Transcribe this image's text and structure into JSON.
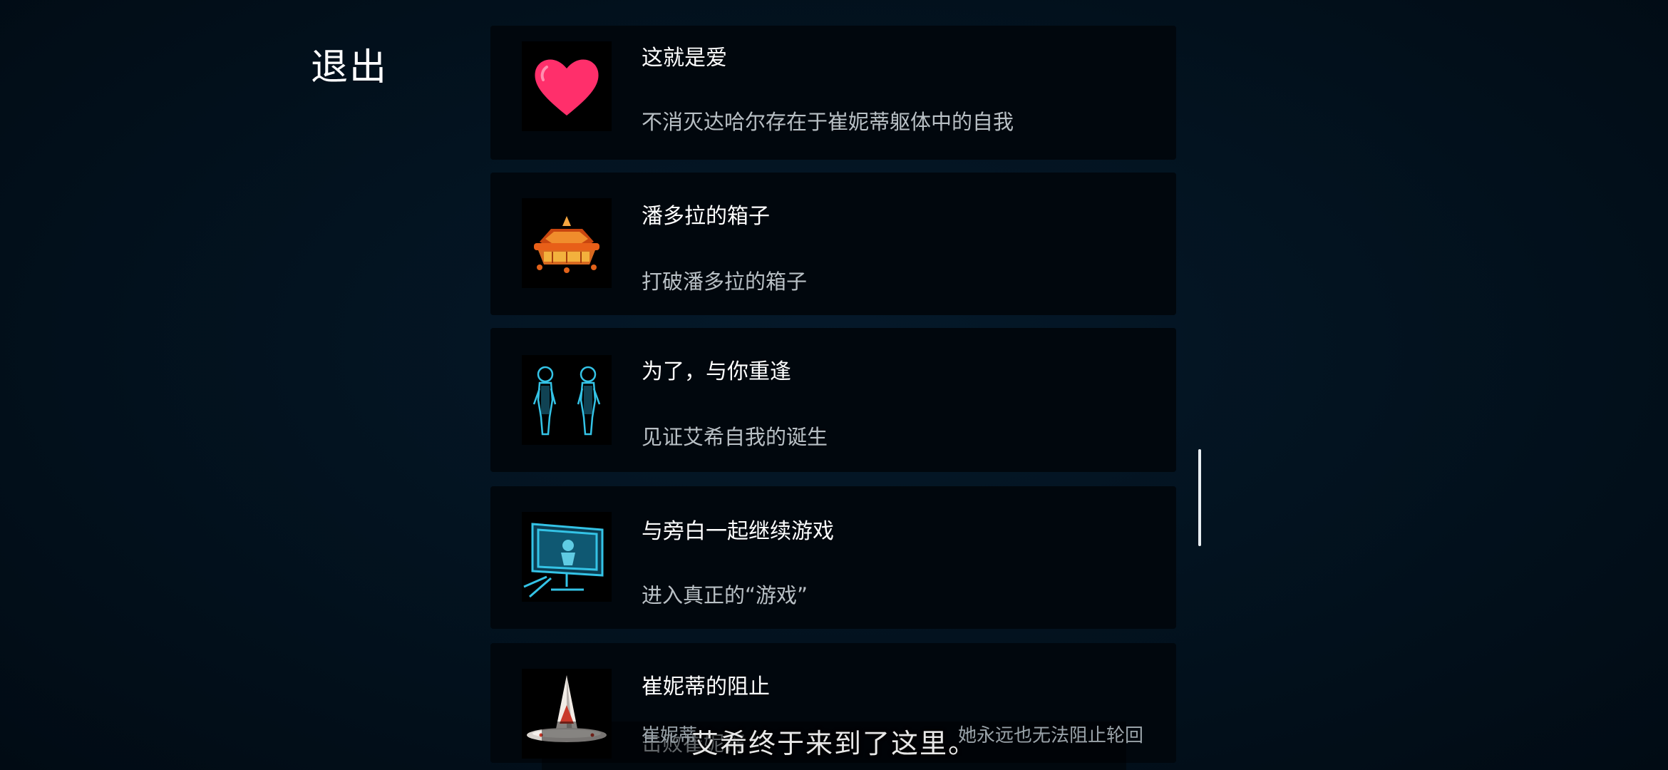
{
  "header": {
    "exit_label": "退出"
  },
  "achievements": [
    {
      "title": "这就是爱",
      "description": "不消灭达哈尔存在于崔妮蒂躯体中的自我",
      "icon": "heart-icon"
    },
    {
      "title": "潘多拉的箱子",
      "description": "打破潘多拉的箱子",
      "icon": "box-icon"
    },
    {
      "title": "为了，与你重逢",
      "description": "见证艾希自我的诞生",
      "icon": "twin-figures-icon"
    },
    {
      "title": "与旁白一起继续游戏",
      "description": "进入真正的“游戏”",
      "icon": "monitor-icon"
    },
    {
      "title": "崔妮蒂的阻止",
      "description": "击败崔妮蒂",
      "icon": "spaceship-icon"
    }
  ],
  "subtitle": {
    "text": "艾希终于来到了这里。",
    "overlay_left": "崔妮蒂",
    "overlay_right": "她永远也无法阻止轮回"
  },
  "colors": {
    "background": "#031320",
    "card": "#01070d",
    "heart": "#ff2f6b",
    "box": "#e2621a",
    "hologram": "#34c3e6"
  }
}
